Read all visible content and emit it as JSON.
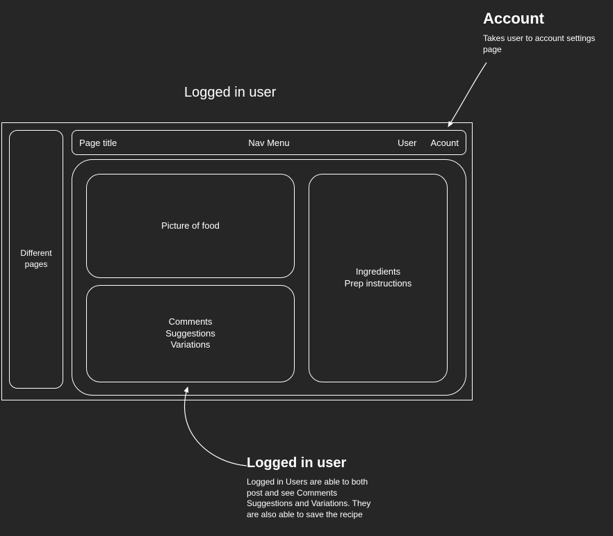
{
  "page_label": "Logged in user",
  "wireframe": {
    "sidebar": "Different pages",
    "topbar": {
      "page_title": "Page title",
      "nav_menu": "Nav Menu",
      "user": "User",
      "account": "Acount"
    },
    "cards": {
      "food": "Picture of food",
      "comments_l1": "Comments",
      "comments_l2": "Suggestions",
      "comments_l3": "Variations",
      "ingredients_l1": "Ingredients",
      "ingredients_l2": "Prep instructions"
    }
  },
  "annotations": {
    "account": {
      "title": "Account",
      "body": "Takes user to account settings page"
    },
    "logged": {
      "title": "Logged in user",
      "body": "Logged in Users are able to both post and see Comments Suggestions and Variations. They are also able to save the recipe"
    }
  }
}
